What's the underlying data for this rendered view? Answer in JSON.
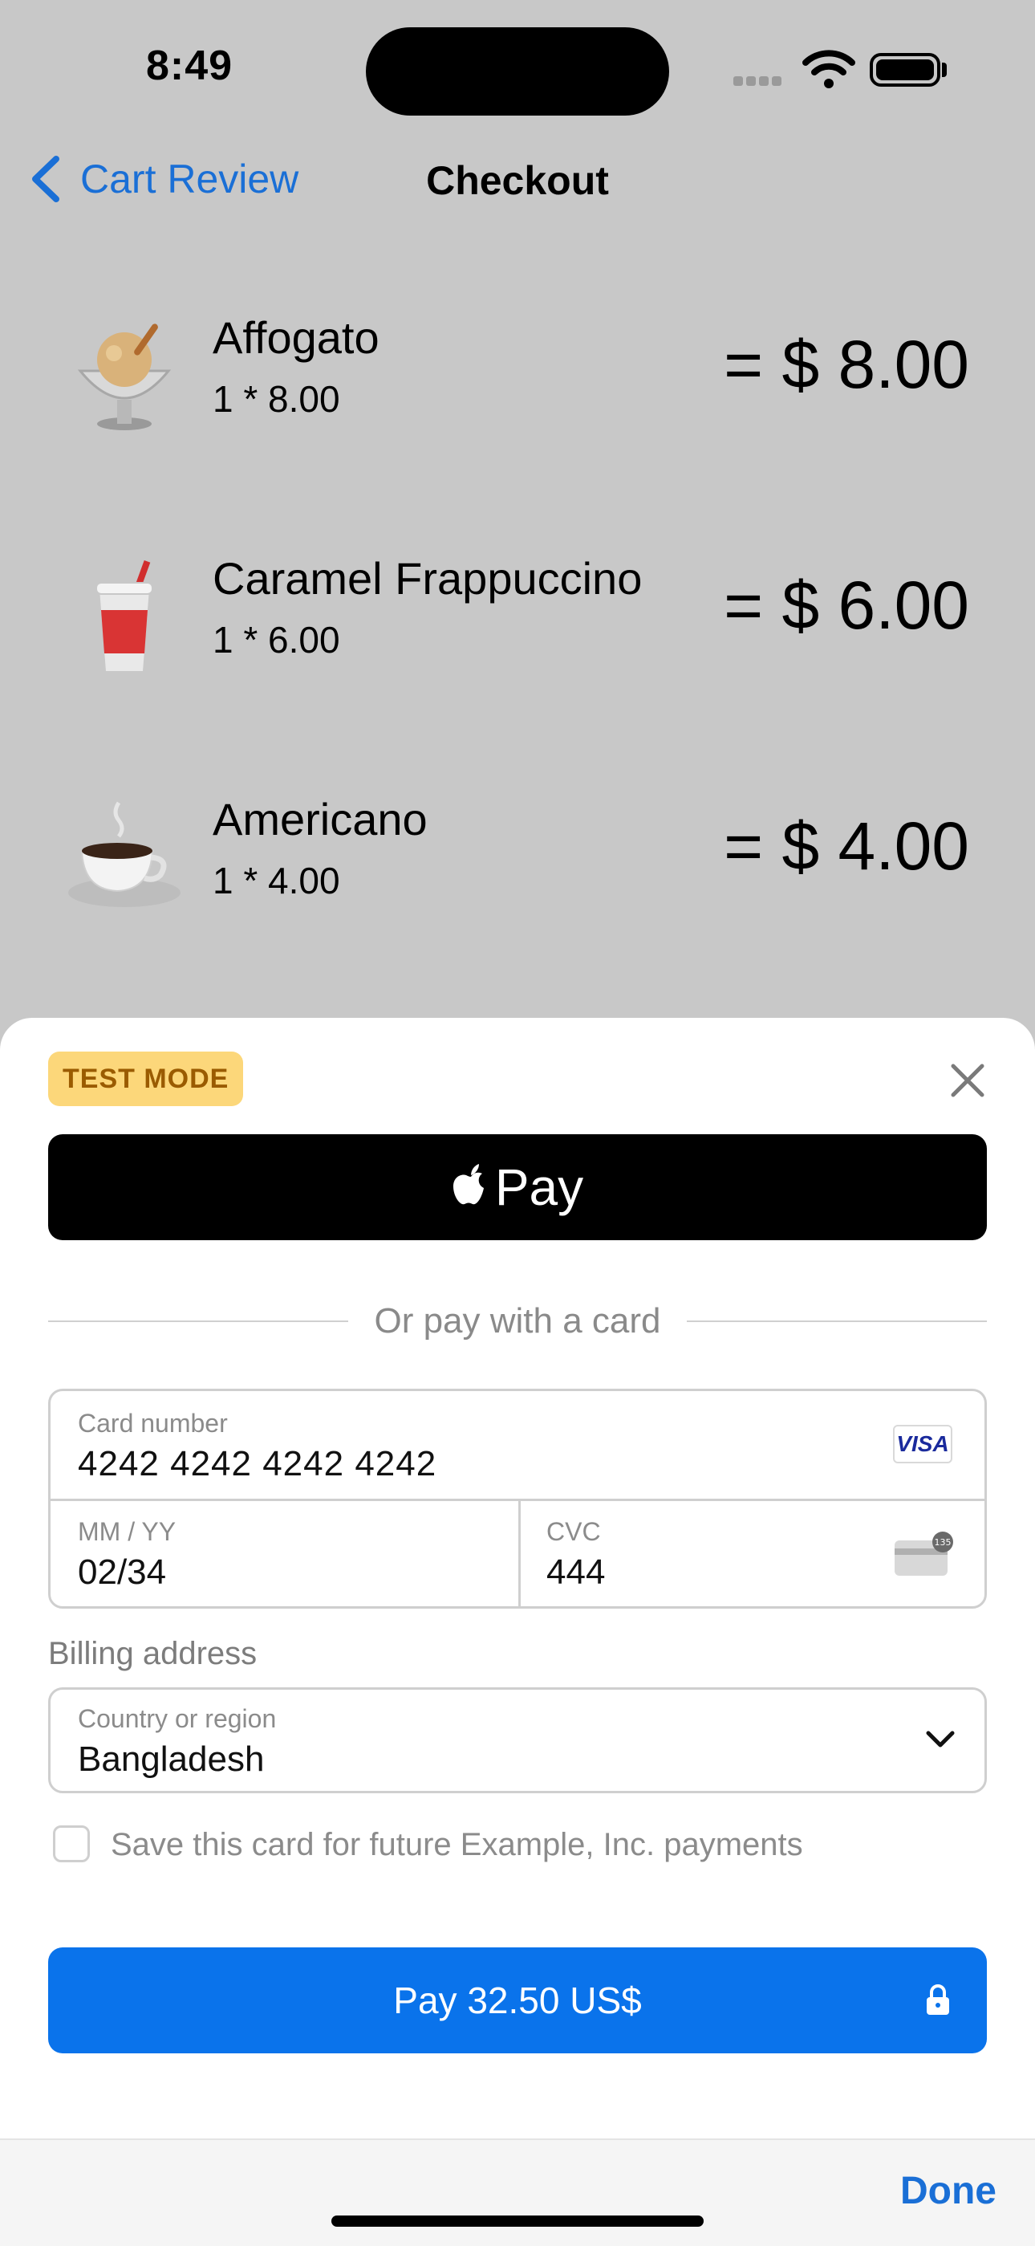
{
  "status_bar": {
    "time": "8:49"
  },
  "nav": {
    "back_label": "Cart Review",
    "title": "Checkout"
  },
  "order_items": [
    {
      "name": "Affogato",
      "quantity_line": "1 * 8.00",
      "total": "= $ 8.00",
      "icon": "affogato-emoji"
    },
    {
      "name": "Caramel Frappuccino",
      "quantity_line": "1 * 6.00",
      "total": "= $ 6.00",
      "icon": "cup-with-straw-emoji"
    },
    {
      "name": "Americano",
      "quantity_line": "1 * 4.00",
      "total": "= $ 4.00",
      "icon": "hot-coffee-emoji"
    }
  ],
  "payment_sheet": {
    "test_mode_badge": "TEST MODE",
    "apple_pay_label": "Pay",
    "divider_text": "Or pay with a card",
    "card_number": {
      "label": "Card number",
      "value": "4242 4242 4242 4242",
      "brand": "VISA"
    },
    "expiry": {
      "label": "MM / YY",
      "value": "02/34"
    },
    "cvc": {
      "label": "CVC",
      "value": "444",
      "icon_badge": "135"
    },
    "billing_address_label": "Billing address",
    "country": {
      "label": "Country or region",
      "value": "Bangladesh"
    },
    "save_card_text": "Save this card for future Example, Inc. payments",
    "save_card_checked": false,
    "pay_button_label": "Pay 32.50 US$"
  },
  "bottom_bar": {
    "done_label": "Done"
  },
  "colors": {
    "accent": "#1a6fd6",
    "pay_button": "#0a73eb",
    "test_badge_bg": "#fcd77a",
    "test_badge_text": "#9a5b00"
  }
}
